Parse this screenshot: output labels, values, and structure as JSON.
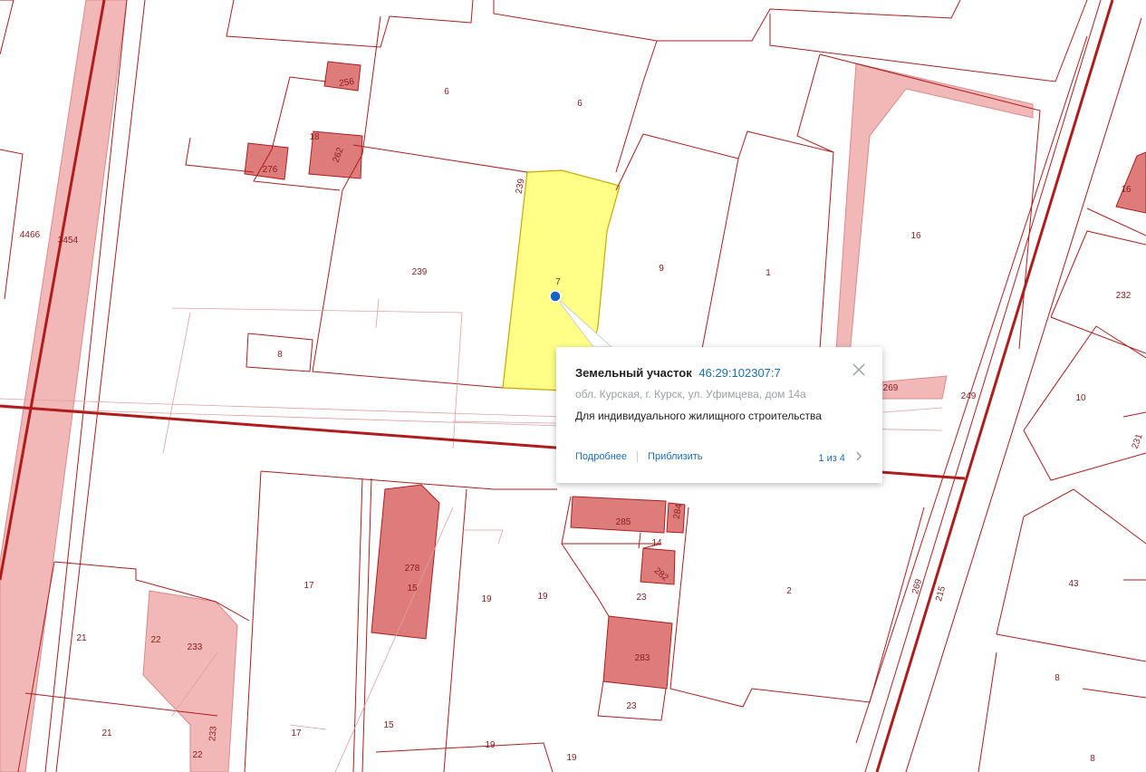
{
  "popup": {
    "title": "Земельный участок",
    "cadastral_number": "46:29:102307:7",
    "address": "обл. Курская, г. Курск, ул. Уфимцева, дом 14а",
    "usage": "Для индивидуального жилищного строительства",
    "details_link": "Подробнее",
    "zoom_link": "Приблизить",
    "pager": "1 из 4",
    "close_icon": "close-icon",
    "next_icon": "chevron-right-icon"
  },
  "map": {
    "border_color": "#b01c1c",
    "selected_fill": "#ffff88",
    "building_fill": "#de7c7c",
    "zone_fill": "#f2b8b8",
    "marker_color": "#1565c0",
    "labels": {
      "l4466": "4466",
      "l3454": "3454",
      "l256": "256",
      "l6a": "6",
      "l6b": "6",
      "l18": "18",
      "l262": "262",
      "l276": "276",
      "l239a": "239",
      "l239b": "239",
      "l7": "7",
      "l9": "9",
      "l1": "1",
      "l16a": "16",
      "l16b": "16",
      "l232": "232",
      "l8a": "8",
      "l269a": "269",
      "l249": "249",
      "l10": "10",
      "l231": "231",
      "l285": "285",
      "l284": "284",
      "l14": "14",
      "l282": "282",
      "l278": "278",
      "l15a": "15",
      "l17a": "17",
      "l19a": "19",
      "l19b": "19",
      "l23a": "23",
      "l2": "2",
      "l269b": "269",
      "l215": "215",
      "l43": "43",
      "l21a": "21",
      "l22a": "22",
      "l233a": "233",
      "l283": "283",
      "l23b": "23",
      "l233b": "233",
      "l21b": "21",
      "l17b": "17",
      "l15b": "15",
      "l19c": "19",
      "l19d": "19",
      "l22b": "22",
      "l8b": "8",
      "l8c": "8"
    }
  }
}
